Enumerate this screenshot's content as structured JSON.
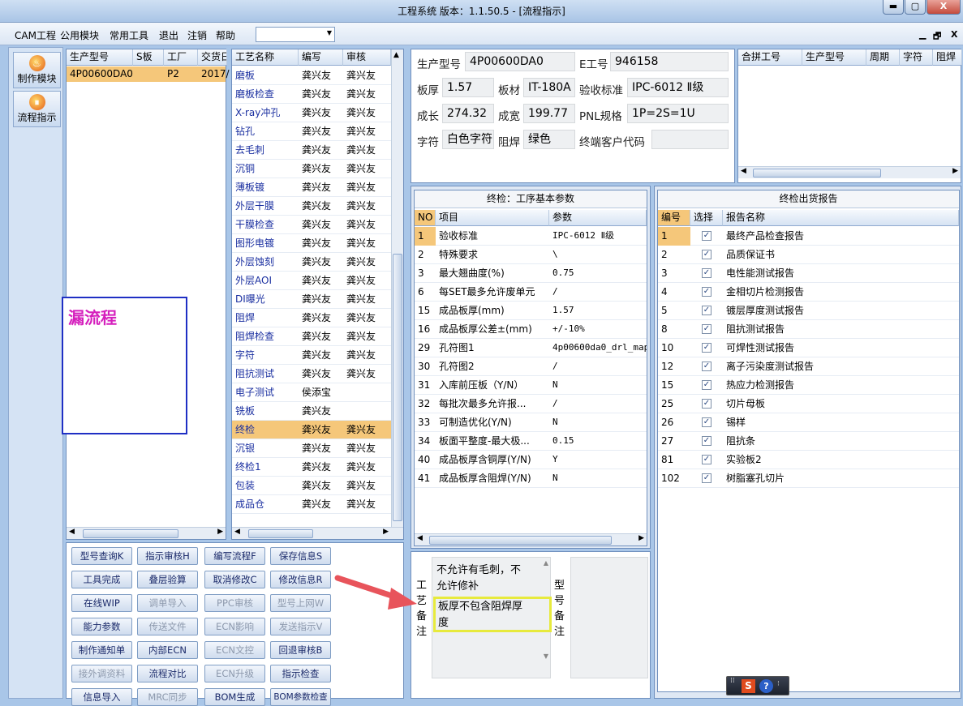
{
  "window": {
    "title": "工程系统   版本：1.1.50.5 - [流程指示]",
    "min": "▬",
    "max": "▢",
    "close": "X"
  },
  "menu": {
    "items": [
      "CAM工程",
      "公用模块",
      "常用工具",
      "退出",
      "注销",
      "帮助"
    ],
    "combo_value": "",
    "mdi": [
      "▁",
      "🗗",
      "X"
    ]
  },
  "leftbar": {
    "buttons": [
      {
        "label": "制作模块",
        "icon": "fire-icon"
      },
      {
        "label": "流程指示",
        "icon": "flow-icon"
      }
    ]
  },
  "model_list": {
    "columns": [
      "生产型号",
      "S板",
      "工厂",
      "交货日"
    ],
    "rows": [
      [
        "4P00600DA0",
        "",
        "P2",
        "2017/"
      ]
    ]
  },
  "annotation": {
    "text": "漏流程"
  },
  "process": {
    "columns": [
      "工艺名称",
      "编写",
      "审核"
    ],
    "rows": [
      [
        "磨板",
        "龚兴友",
        "龚兴友"
      ],
      [
        "磨板检查",
        "龚兴友",
        "龚兴友"
      ],
      [
        "X-ray冲孔",
        "龚兴友",
        "龚兴友"
      ],
      [
        "钻孔",
        "龚兴友",
        "龚兴友"
      ],
      [
        "去毛刺",
        "龚兴友",
        "龚兴友"
      ],
      [
        "沉铜",
        "龚兴友",
        "龚兴友"
      ],
      [
        "薄板镀",
        "龚兴友",
        "龚兴友"
      ],
      [
        "外层干膜",
        "龚兴友",
        "龚兴友"
      ],
      [
        "干膜检查",
        "龚兴友",
        "龚兴友"
      ],
      [
        "图形电镀",
        "龚兴友",
        "龚兴友"
      ],
      [
        "外层蚀刻",
        "龚兴友",
        "龚兴友"
      ],
      [
        "外层AOI",
        "龚兴友",
        "龚兴友"
      ],
      [
        "DI曝光",
        "龚兴友",
        "龚兴友"
      ],
      [
        "阻焊",
        "龚兴友",
        "龚兴友"
      ],
      [
        "阻焊检查",
        "龚兴友",
        "龚兴友"
      ],
      [
        "字符",
        "龚兴友",
        "龚兴友"
      ],
      [
        "阻抗测试",
        "龚兴友",
        "龚兴友"
      ],
      [
        "电子测试",
        "侯添宝",
        ""
      ],
      [
        "铣板",
        "龚兴友",
        ""
      ],
      [
        "终检",
        "龚兴友",
        "龚兴友"
      ],
      [
        "沉银",
        "龚兴友",
        "龚兴友"
      ],
      [
        "终检1",
        "龚兴友",
        "龚兴友"
      ],
      [
        "包装",
        "龚兴友",
        "龚兴友"
      ],
      [
        "成品仓",
        "龚兴友",
        "龚兴友"
      ]
    ],
    "selected_index": 19
  },
  "buttons": [
    [
      "型号查询K",
      "指示审核H",
      "编写流程F",
      "保存信息S"
    ],
    [
      "工具完成",
      "叠层验算",
      "取消修改C",
      "修改信息R"
    ],
    [
      "在线WIP",
      "调单导入",
      "PPC审核",
      "型号上网W"
    ],
    [
      "能力参数",
      "传送文件",
      "ECN影响",
      "发送指示V"
    ],
    [
      "制作通知单",
      "内部ECN",
      "ECN文控",
      "回退审核B"
    ],
    [
      "接外调资料",
      "流程对比",
      "ECN升级",
      "指示检查"
    ],
    [
      "信息导入",
      "MRC同步",
      "BOM生成",
      "BOM参数检查"
    ]
  ],
  "disabled_buttons": [
    "调单导入",
    "PPC审核",
    "型号上网W",
    "传送文件",
    "ECN影响",
    "发送指示V",
    "ECN文控",
    "接外调资料",
    "ECN升级",
    "MRC同步"
  ],
  "info": {
    "model_label": "生产型号",
    "model": "4P00600DA0",
    "e_label": "E工号",
    "e": "946158",
    "thick_label": "板厚",
    "thick": "1.57",
    "mat_label": "板材",
    "mat": "IT-180A",
    "std_label": "验收标准",
    "std": "IPC-6012 Ⅱ级",
    "len_label": "成长",
    "len": "274.32",
    "wid_label": "成宽",
    "wid": "199.77",
    "pnl_label": "PNL规格",
    "pnl": "1P=2S=1U",
    "char_label": "字符",
    "char": "白色字符",
    "mask_label": "阻焊",
    "mask": "绿色",
    "cust_label": "终端客户代码",
    "cust": ""
  },
  "combine": {
    "columns": [
      "合拼工号",
      "生产型号",
      "周期",
      "字符",
      "阻焊"
    ]
  },
  "params": {
    "title": "终检：工序基本参数",
    "columns": [
      "NO",
      "项目",
      "参数"
    ],
    "rows": [
      [
        "1",
        "验收标准",
        "IPC-6012 Ⅱ级"
      ],
      [
        "2",
        "特殊要求",
        "\\"
      ],
      [
        "3",
        "最大翘曲度(%)",
        "0.75"
      ],
      [
        "6",
        "每SET最多允许废单元",
        "/"
      ],
      [
        "15",
        "成品板厚(mm)",
        "1.57"
      ],
      [
        "16",
        "成品板厚公差±(mm)",
        "+/-10%"
      ],
      [
        "29",
        "孔符图1",
        "4p00600da0_drl_map"
      ],
      [
        "30",
        "孔符图2",
        "/"
      ],
      [
        "31",
        "入库前压板（Y/N）",
        "N"
      ],
      [
        "32",
        "每批次最多允许报...",
        "/"
      ],
      [
        "33",
        "可制造优化(Y/N)",
        "N"
      ],
      [
        "34",
        "板面平整度-最大极...",
        "0.15"
      ],
      [
        "40",
        "成品板厚含铜厚(Y/N)",
        "Y"
      ],
      [
        "41",
        "成品板厚含阻焊(Y/N)",
        "N"
      ]
    ]
  },
  "reports": {
    "title": "终检出货报告",
    "columns": [
      "编号",
      "选择",
      "报告名称"
    ],
    "rows": [
      [
        "1",
        "最终产品检查报告"
      ],
      [
        "2",
        "品质保证书"
      ],
      [
        "3",
        "电性能测试报告"
      ],
      [
        "4",
        "金相切片检测报告"
      ],
      [
        "5",
        "镀层厚度测试报告"
      ],
      [
        "8",
        "阻抗测试报告"
      ],
      [
        "10",
        "可焊性测试报告"
      ],
      [
        "12",
        "离子污染度测试报告"
      ],
      [
        "15",
        "热应力检测报告"
      ],
      [
        "25",
        "切片母板"
      ],
      [
        "26",
        "锡样"
      ],
      [
        "27",
        "阻抗条"
      ],
      [
        "81",
        "实验板2"
      ],
      [
        "102",
        "树脂塞孔切片"
      ]
    ],
    "check": "✓"
  },
  "remarks": {
    "proc_label": [
      "工",
      "艺",
      "备",
      "注"
    ],
    "proc_lines": [
      "不允许有毛刺，不",
      "允许修补"
    ],
    "proc_highlight": [
      "板厚不包含阻焊厚",
      "度"
    ],
    "model_label": [
      "型",
      "号",
      "备",
      "注"
    ]
  },
  "taskbar": {
    "icons": [
      "S",
      "?"
    ]
  }
}
